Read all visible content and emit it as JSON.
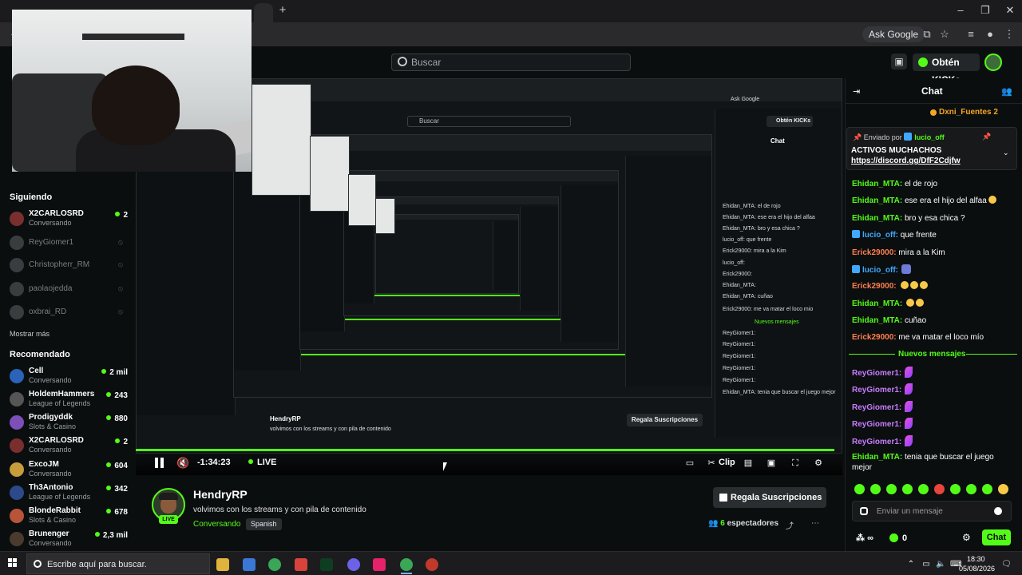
{
  "browser": {
    "ask_google": "Ask Google"
  },
  "header": {
    "search_placeholder": "Buscar",
    "kicks_label": "Obtén KICKs"
  },
  "sidebar": {
    "following_heading": "Siguiendo",
    "following": [
      {
        "name": "X2CARLOSRD",
        "status": "Conversando",
        "count": "2",
        "live": true
      },
      {
        "name": "ReyGiomer1",
        "live": false
      },
      {
        "name": "Christopherr_RM",
        "live": false
      },
      {
        "name": "paolaojedda",
        "live": false
      },
      {
        "name": "oxbrai_RD",
        "live": false
      }
    ],
    "show_more": "Mostrar más",
    "recommended_heading": "Recomendado",
    "recommended": [
      {
        "name": "Cell",
        "category": "Conversando",
        "count": "2 mil"
      },
      {
        "name": "HoldemHammers",
        "category": "League of Legends",
        "count": "243"
      },
      {
        "name": "Prodigyddk",
        "category": "Slots & Casino",
        "count": "880"
      },
      {
        "name": "X2CARLOSRD",
        "category": "Conversando",
        "count": "2"
      },
      {
        "name": "ExcoJM",
        "category": "Conversando",
        "count": "604"
      },
      {
        "name": "Th3Antonio",
        "category": "League of Legends",
        "count": "342"
      },
      {
        "name": "BlondeRabbit",
        "category": "Slots & Casino",
        "count": "678"
      },
      {
        "name": "Brunenger",
        "category": "Conversando",
        "count": "2,3 mil"
      }
    ]
  },
  "player": {
    "time": "-1:34:23",
    "live_label": "LIVE",
    "clip_label": "Clip",
    "progress_fraction": 1.0
  },
  "nested": {
    "search": "Buscar",
    "kicks": "Obtén KICKs",
    "ask_google": "Ask Google",
    "chat_title": "Chat",
    "streamer": "HendryRP",
    "title": "volvimos con los streams y con pila de contenido",
    "gift": "Regala Suscripciones",
    "messages": [
      "Ehidan_MTA: el de rojo",
      "Ehidan_MTA: ese era el hijo del alfaa",
      "Ehidan_MTA: bro y esa chica ?",
      "lucio_off: que frente",
      "Erick29000: mira a la Kim",
      "lucio_off:",
      "Erick29000:",
      "Ehidan_MTA:",
      "Ehidan_MTA: cuñao",
      "Erick29000: me va matar el loco mio",
      "Nuevos mensajes",
      "ReyGiomer1:",
      "ReyGiomer1:",
      "ReyGiomer1:",
      "ReyGiomer1:",
      "ReyGiomer1:",
      "Ehidan_MTA: tenia que buscar el juego mejor"
    ]
  },
  "stream": {
    "streamer": "HendryRP",
    "live_badge": "LIVE",
    "title": "volvimos con los streams y con pila de contenido",
    "category": "Conversando",
    "language": "Spanish",
    "gift_button": "Regala Suscripciones",
    "viewers_count": "6",
    "viewers_label": "espectadores"
  },
  "chat": {
    "title": "Chat",
    "top_gifter": "Dxni_Fuentes",
    "top_gifter_count": "2",
    "pinned_prefix": "Enviado por",
    "pinned_by": "lucio_off",
    "pinned_text": "ACTIVOS MUCHACHOS",
    "pinned_link": "https://discord.gg/DfF2Cdjfw",
    "messages": [
      {
        "user": "Ehidan_MTA:",
        "text": "el de rojo",
        "color": "green"
      },
      {
        "user": "Ehidan_MTA:",
        "text": "ese era el hijo del alfaa",
        "color": "green"
      },
      {
        "user": "Ehidan_MTA:",
        "text": "bro y esa chica ?",
        "color": "green"
      },
      {
        "user": "lucio_off:",
        "text": "que frente",
        "color": "blue"
      },
      {
        "user": "Erick29000:",
        "text": "mira a la Kim",
        "color": "orange"
      },
      {
        "user": "lucio_off:",
        "text": "",
        "color": "blue"
      },
      {
        "user": "Erick29000:",
        "text": "",
        "color": "orange"
      },
      {
        "user": "Ehidan_MTA:",
        "text": "",
        "color": "green"
      },
      {
        "user": "Ehidan_MTA:",
        "text": "cuñao",
        "color": "green"
      },
      {
        "user": "Erick29000:",
        "text": "me va matar el loco mío",
        "color": "orange"
      }
    ],
    "new_messages": "Nuevos mensajes",
    "new_messages_list": [
      {
        "user": "ReyGiomer1:",
        "color": "pink"
      },
      {
        "user": "ReyGiomer1:",
        "color": "pink"
      },
      {
        "user": "ReyGiomer1:",
        "color": "pink"
      },
      {
        "user": "ReyGiomer1:",
        "color": "pink"
      },
      {
        "user": "ReyGiomer1:",
        "color": "pink"
      }
    ],
    "last_message_user": "Ehidan_MTA:",
    "last_message_text": "tenia que buscar el juego mejor",
    "input_placeholder": "Enviar un mensaje",
    "points": "∞",
    "kicks": "0",
    "send_label": "Chat"
  },
  "taskbar": {
    "search_placeholder": "Escribe aquí para buscar.",
    "time": "18:30",
    "date": "05/08/2026"
  },
  "colors": {
    "kick_green": "#53fc18",
    "background": "#0b0e0f"
  }
}
